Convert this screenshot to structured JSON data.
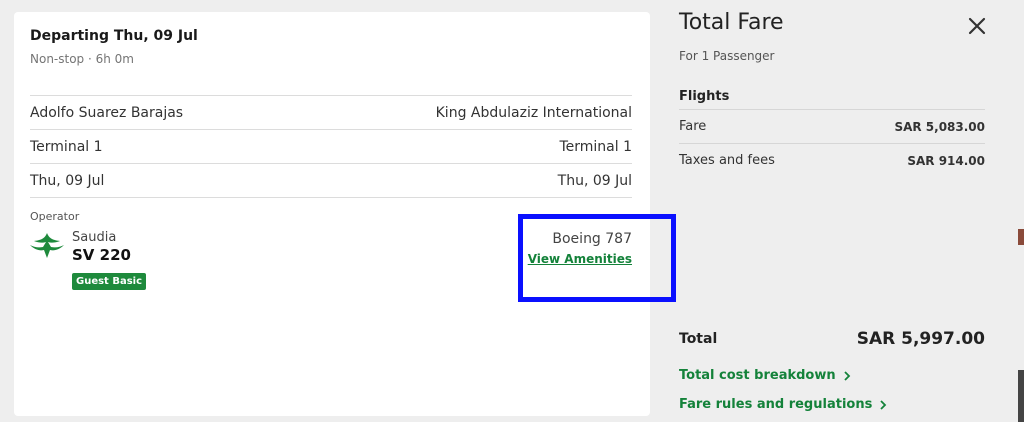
{
  "flight": {
    "departing": "Departing Thu, 09 Jul",
    "summary": "Non-stop · 6h 0m",
    "rows": [
      {
        "left": "Adolfo Suarez Barajas",
        "right": "King Abdulaziz International"
      },
      {
        "left": "Terminal 1",
        "right": "Terminal 1"
      },
      {
        "left": "Thu, 09 Jul",
        "right": "Thu, 09 Jul"
      }
    ],
    "operator_label": "Operator",
    "airline": "Saudia",
    "flight_number": "SV 220",
    "fare_class": "Guest Basic",
    "aircraft": "Boeing 787",
    "amenities_link": "View Amenities"
  },
  "fare": {
    "title": "Total Fare",
    "passengers": "For 1 Passenger",
    "section": "Flights",
    "items": [
      {
        "label": "Fare",
        "value": "SAR 5,083.00"
      },
      {
        "label": "Taxes and fees",
        "value": "SAR 914.00"
      }
    ],
    "total_label": "Total",
    "total_value": "SAR 5,997.00",
    "breakdown_link": "Total cost breakdown",
    "rules_link": "Fare rules and regulations"
  },
  "colors": {
    "accent_green": "#14823a",
    "badge_green": "#1e8a3c",
    "highlight_blue": "#0a10ff"
  },
  "icons": [
    "saudia-logo-icon",
    "close-icon",
    "chevron-right-icon"
  ]
}
